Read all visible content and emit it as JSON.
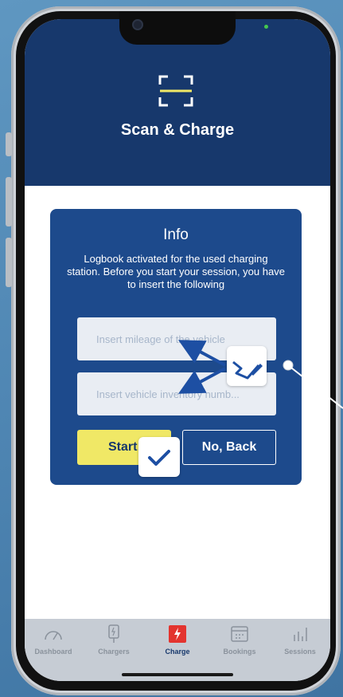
{
  "header": {
    "title": "Scan & Charge",
    "icon": "scan-frame-icon",
    "background": "#17386c"
  },
  "info_card": {
    "title": "Info",
    "message": "Logbook activated for the used charging station. Before you start your session, you have to insert the following",
    "mileage_input": {
      "placeholder": "Insert mileage of the vehicle",
      "value": ""
    },
    "inventory_input": {
      "placeholder": "Insert vehicle inventory numb...",
      "value": ""
    },
    "start_label": "Start",
    "back_label": "No, Back",
    "start_color": "#f0e866"
  },
  "annotations": {
    "check_icon": "check-icon",
    "edit_icon": "pen-edit-icon"
  },
  "tabbar": {
    "items": [
      {
        "label": "Dashboard",
        "icon": "speedometer-icon"
      },
      {
        "label": "Chargers",
        "icon": "charger-icon"
      },
      {
        "label": "Charge",
        "icon": "lightning-icon",
        "active": true
      },
      {
        "label": "Bookings",
        "icon": "calendar-icon"
      },
      {
        "label": "Sessions",
        "icon": "bar-chart-icon"
      }
    ],
    "active_color": "#17386c",
    "accent": "#e3342f"
  }
}
